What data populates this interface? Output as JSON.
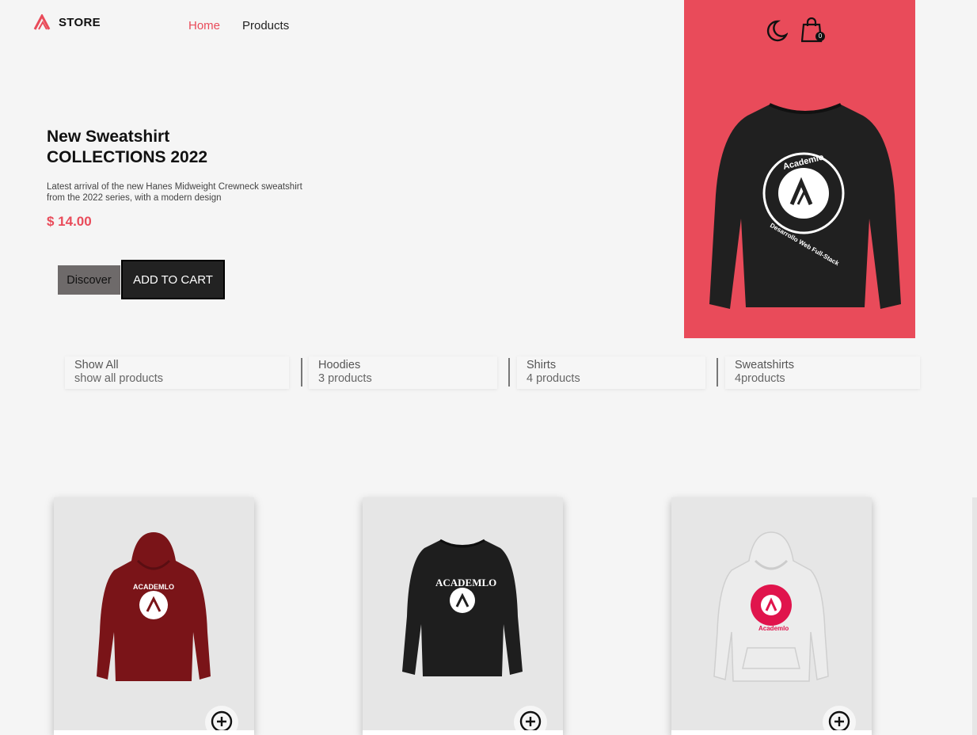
{
  "header": {
    "logo_text": "STORE",
    "nav": [
      {
        "label": "Home",
        "active": true
      },
      {
        "label": "Products",
        "active": false
      }
    ],
    "cart_count": "0",
    "accent_color": "#e94b5a"
  },
  "hero": {
    "title_line1": "New Sweatshirt",
    "title_line2": "COLLECTIONS 2022",
    "description_line1": "Latest arrival of the new Hanes Midweight Crewneck sweatshirt",
    "description_line2": "from the 2022 series, with a modern design",
    "price": "$ 14.00",
    "discover_label": "Discover",
    "add_to_cart_label": "ADD TO CART",
    "panel_color": "#e94b5a",
    "image_brand": "Academlo",
    "image_tagline": "Desarrollo Web Full-Stack"
  },
  "filters": [
    {
      "title": "Show All",
      "subtitle": "show all products"
    },
    {
      "title": "Hoodies",
      "subtitle": "3 products"
    },
    {
      "title": "Shirts",
      "subtitle": "4 products"
    },
    {
      "title": "Sweatshirts",
      "subtitle": "4products"
    }
  ],
  "products": [
    {
      "image": "maroon hoodie",
      "print_text": "ACADEMLO",
      "color": "#7a1418"
    },
    {
      "image": "black sweatshirt",
      "print_text": "ACADEMLO",
      "color": "#1e1e1e"
    },
    {
      "image": "white hoodie",
      "print_text": "Academlo",
      "color": "#e8e8e8"
    }
  ],
  "icons": [
    "academlo-logo-icon",
    "moon-icon",
    "shopping-bag-icon",
    "plus-circle-icon"
  ]
}
